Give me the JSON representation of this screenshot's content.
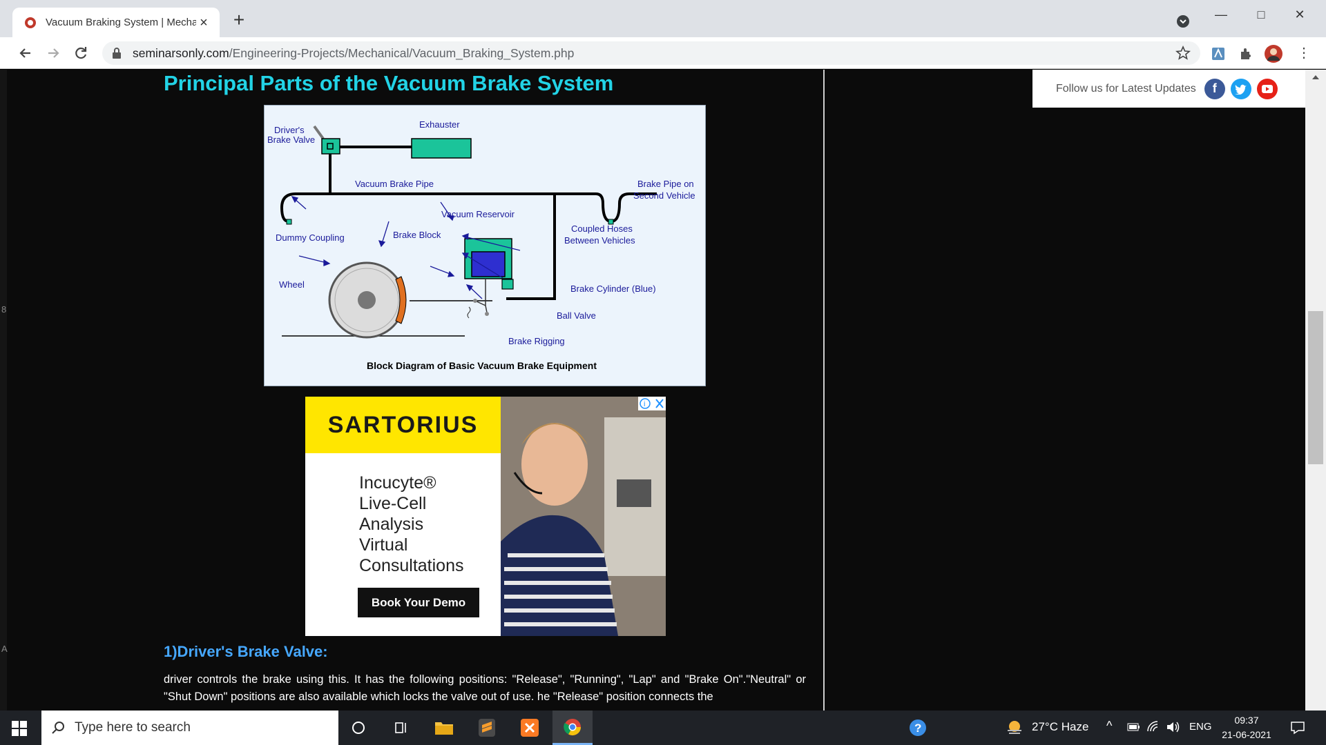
{
  "browser": {
    "tab_title": "Vacuum Braking System | Mechar",
    "url_host": "seminarsonly.com",
    "url_path": "/Engineering-Projects/Mechanical/Vacuum_Braking_System.php"
  },
  "page": {
    "section_title": "Principal Parts of the Vacuum Brake System",
    "diagram": {
      "labels": {
        "drivers_valve": [
          "Driver's",
          "Brake Valve"
        ],
        "exhauster": "Exhauster",
        "brake_pipe": "Vacuum Brake Pipe",
        "brake_pipe_second": [
          "Brake Pipe on",
          "Second Vehicle"
        ],
        "vacuum_reservoir": "Vacuum Reservoir",
        "coupled_hoses": [
          "Coupled Hoses",
          "Between Vehicles"
        ],
        "dummy_coupling": "Dummy Coupling",
        "brake_block": "Brake Block",
        "wheel": "Wheel",
        "brake_cylinder": "Brake Cylinder (Blue)",
        "ball_valve": "Ball Valve",
        "brake_rigging": "Brake Rigging"
      },
      "caption": "Block Diagram of Basic Vacuum Brake Equipment"
    },
    "ad": {
      "brand": "SARTORIUS",
      "headline": [
        "Incucyte®",
        "Live-Cell",
        "Analysis",
        "Virtual",
        "Consultations"
      ],
      "cta": "Book Your Demo"
    },
    "subsection_title": "1)Driver's Brake Valve:",
    "paragraph": "driver controls the brake using this. It has the following positions: \"Release\", \"Running\", \"Lap\" and \"Brake On\".\"Neutral\" or \"Shut Down\" positions are also available which locks the valve out of use. he \"Release\" position connects the",
    "follow_text": "Follow us for Latest Updates",
    "left_edge_chars": [
      "8",
      "A"
    ]
  },
  "taskbar": {
    "search_placeholder": "Type here to search",
    "weather": "27°C  Haze",
    "language": "ENG",
    "time": "09:37",
    "date": "21-06-2021"
  },
  "colors": {
    "title_cyan": "#22d3e6",
    "subtitle_blue": "#46a8ff",
    "ad_yellow": "#ffe600",
    "facebook": "#3b5998",
    "twitter": "#1da1f2",
    "youtube": "#e62117"
  }
}
